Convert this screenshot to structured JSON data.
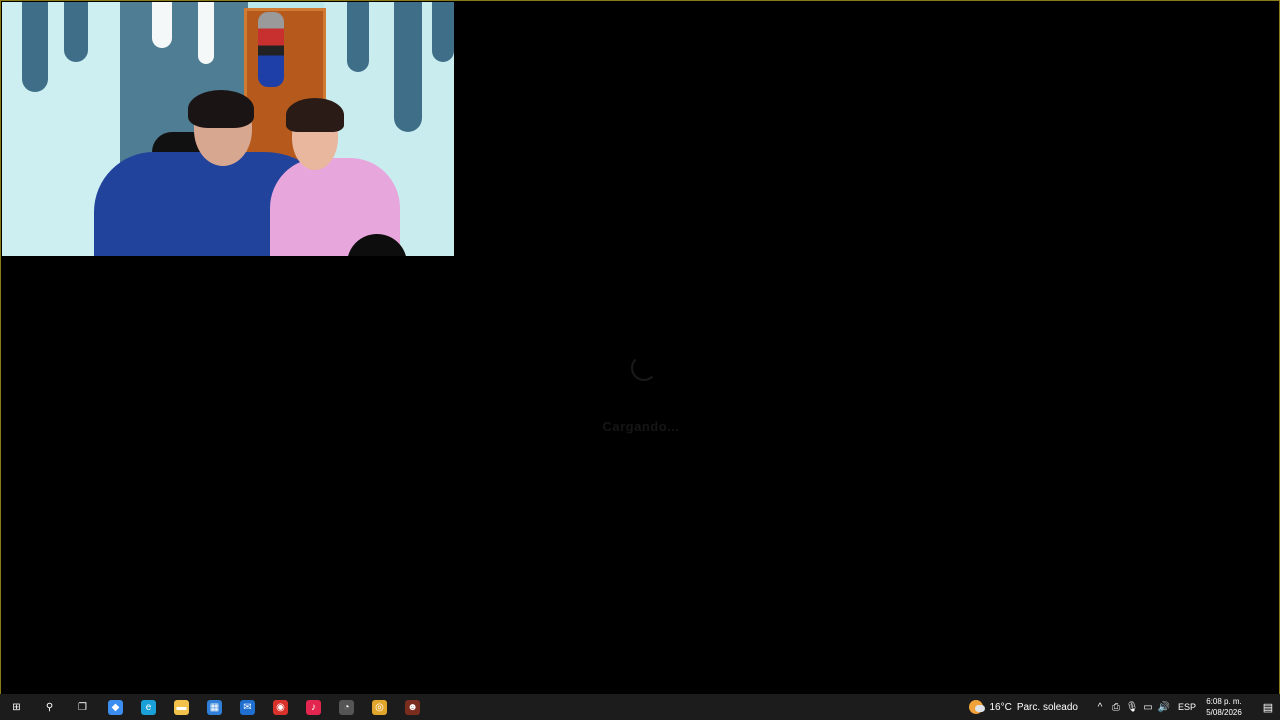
{
  "loading": {
    "text": "Cargando..."
  },
  "taskbar": {
    "icons": [
      {
        "name": "start-icon",
        "glyph": "⊞",
        "color": "#ffffff"
      },
      {
        "name": "search-icon",
        "glyph": "⚲",
        "color": "#ffffff"
      },
      {
        "name": "task-view-icon",
        "glyph": "❐",
        "color": "#ffffff"
      },
      {
        "name": "copilot-icon",
        "glyph": "◆",
        "color": "#3b8ef0"
      },
      {
        "name": "edge-icon",
        "glyph": "e",
        "color": "#1aa0d8"
      },
      {
        "name": "file-explorer-icon",
        "glyph": "▬",
        "color": "#f2c14b"
      },
      {
        "name": "store-icon",
        "glyph": "▦",
        "color": "#2f7fd8"
      },
      {
        "name": "outlook-icon",
        "glyph": "✉",
        "color": "#1f6fd0"
      },
      {
        "name": "app-red-icon",
        "glyph": "◉",
        "color": "#d8312b"
      },
      {
        "name": "tiktok-icon",
        "glyph": "♪",
        "color": "#e3264f"
      },
      {
        "name": "app-gauge-icon",
        "glyph": "◔",
        "color": "#555555"
      },
      {
        "name": "chrome-icon",
        "glyph": "◎",
        "color": "#e0a62c"
      },
      {
        "name": "app-avatar-icon",
        "glyph": "☻",
        "color": "#7a2c1e"
      }
    ],
    "weather": {
      "temp": "16°C",
      "condition": "Parc. soleado"
    },
    "tray_icons": [
      {
        "name": "show-hidden-icons-icon",
        "glyph": "^"
      },
      {
        "name": "usb-icon",
        "glyph": "⎙"
      },
      {
        "name": "microphone-icon",
        "glyph": "🎙"
      },
      {
        "name": "network-icon",
        "glyph": "▭"
      },
      {
        "name": "volume-icon",
        "glyph": "🔊"
      }
    ],
    "language": "ESP",
    "time": "6:08 p. m.",
    "date": "5/08/2026",
    "notification_glyph": "▤"
  }
}
